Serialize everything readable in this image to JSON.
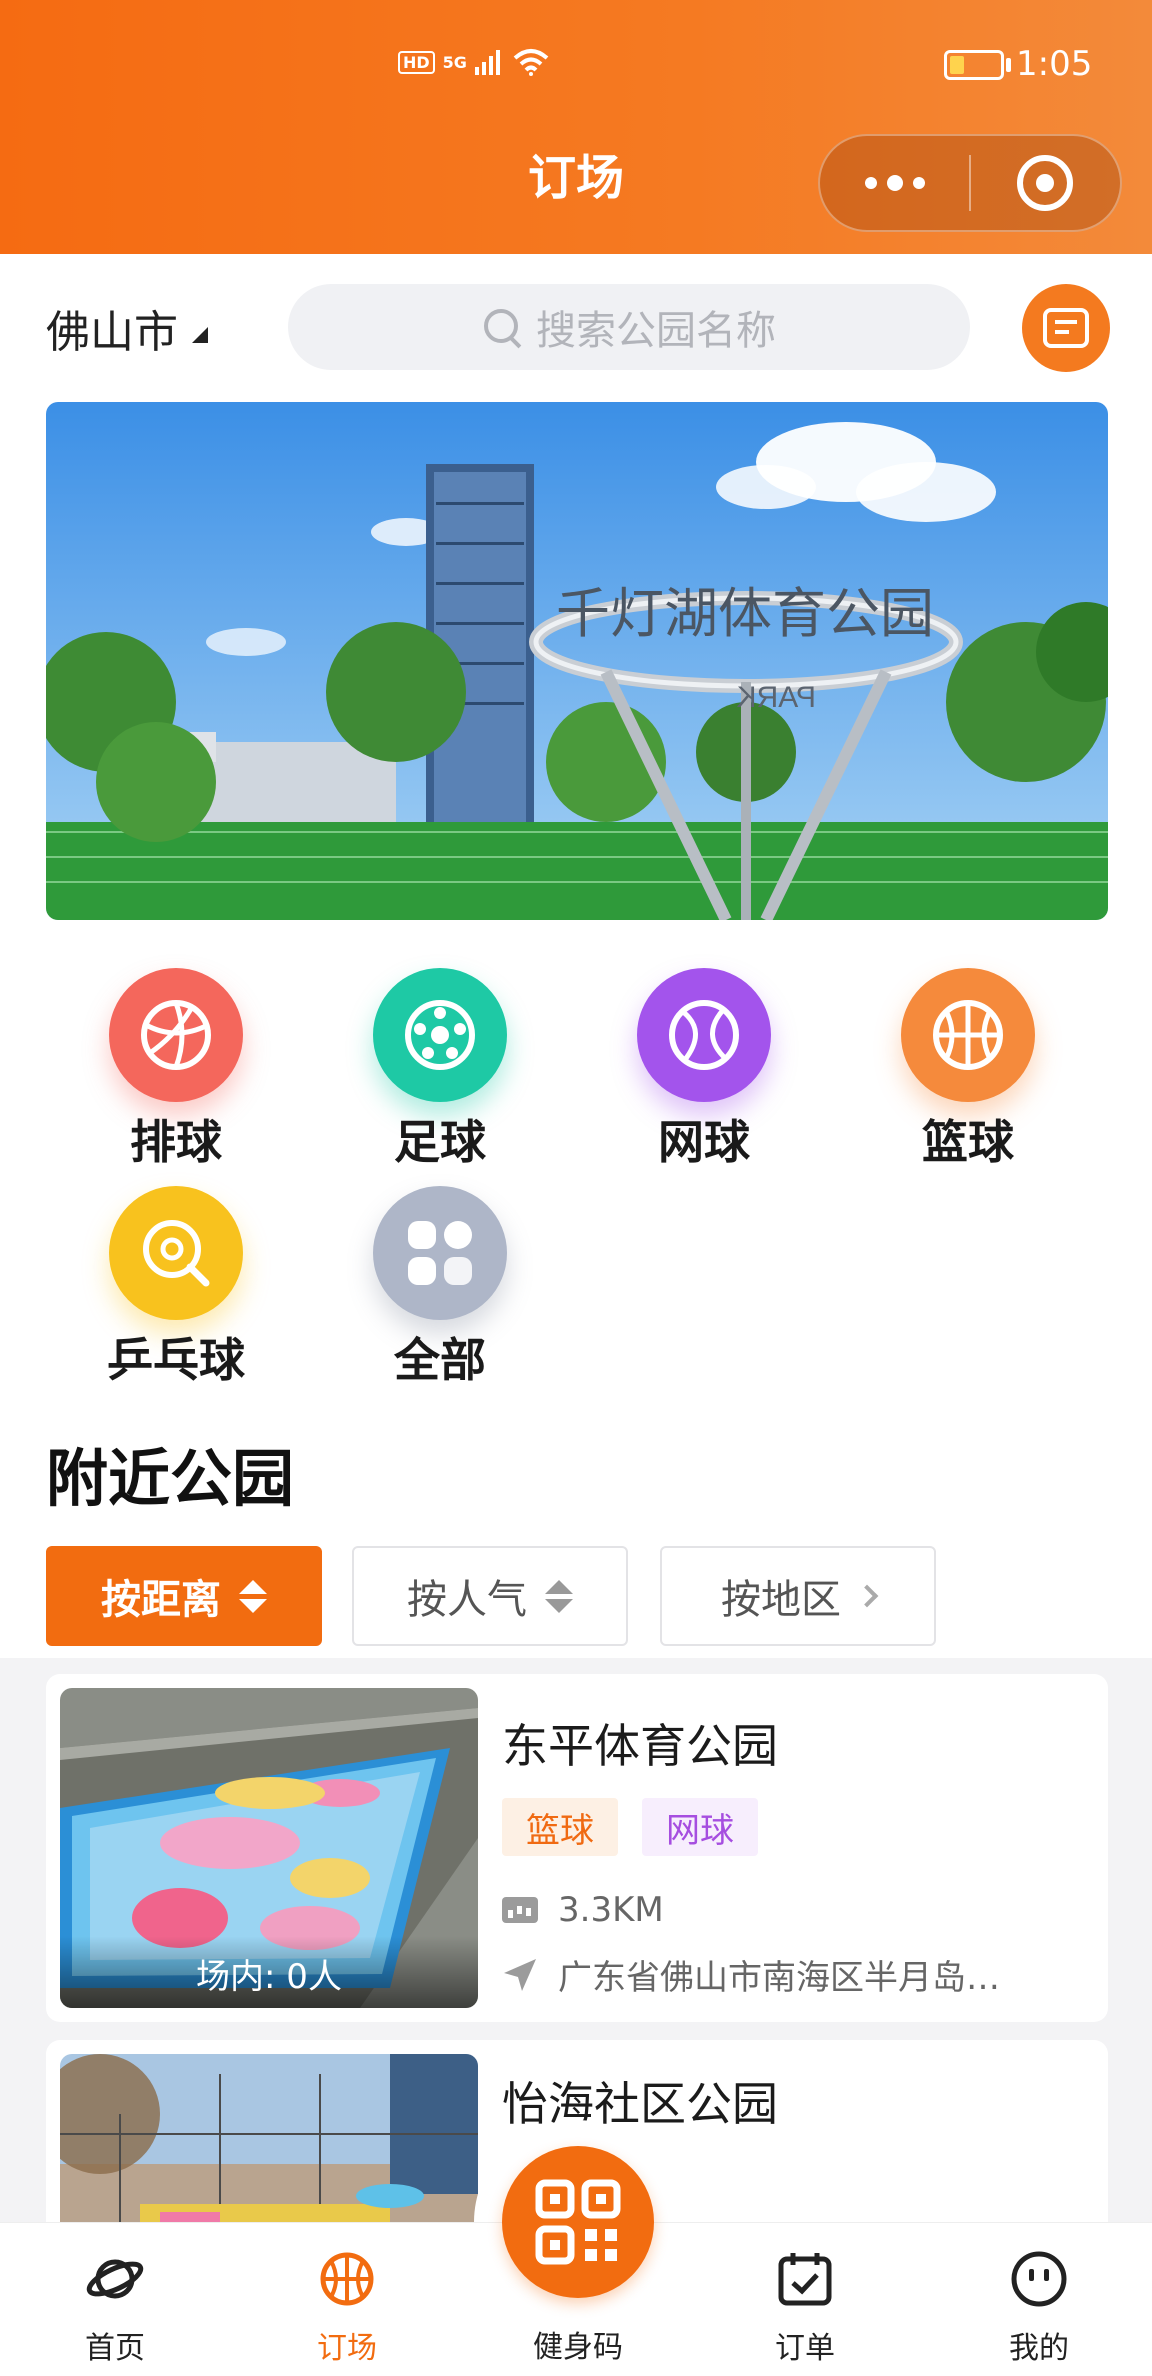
{
  "status_bar": {
    "signal": "5G",
    "hd": "HD",
    "time": "1:05"
  },
  "header": {
    "title": "订场"
  },
  "search_row": {
    "city": "佛山市",
    "placeholder": "搜索公园名称"
  },
  "banner": {
    "sign_text": "千灯湖体育公园",
    "sign_text_back": "PARK"
  },
  "categories": [
    {
      "label": "排球",
      "icon": "volleyball-icon",
      "color": "#f4675c"
    },
    {
      "label": "足球",
      "icon": "soccer-ball-icon",
      "color": "#1ec9a5"
    },
    {
      "label": "网球",
      "icon": "tennis-ball-icon",
      "color": "#a354ec"
    },
    {
      "label": "篮球",
      "icon": "basketball-icon",
      "color": "#f58a3c"
    },
    {
      "label": "乒乓球",
      "icon": "ping-pong-icon",
      "color": "#f8c21e"
    },
    {
      "label": "全部",
      "icon": "grid-all-icon",
      "color": "#aeb6c8"
    }
  ],
  "nearby": {
    "title": "附近公园",
    "sort": {
      "distance": "按距离",
      "popularity": "按人气",
      "region": "按地区"
    },
    "parks": [
      {
        "name": "东平体育公园",
        "tags": [
          "篮球",
          "网球"
        ],
        "distance": "3.3KM",
        "address": "广东省佛山市南海区半月岛…",
        "occupancy": "场内: 0人"
      },
      {
        "name": "怡海社区公园"
      }
    ]
  },
  "tabbar": {
    "home": "首页",
    "booking": "订场",
    "fitness_code": "健身码",
    "orders": "订单",
    "mine": "我的"
  },
  "colors": {
    "accent": "#f26c10",
    "header_start": "#f56b12",
    "header_end": "#f38a3a"
  }
}
